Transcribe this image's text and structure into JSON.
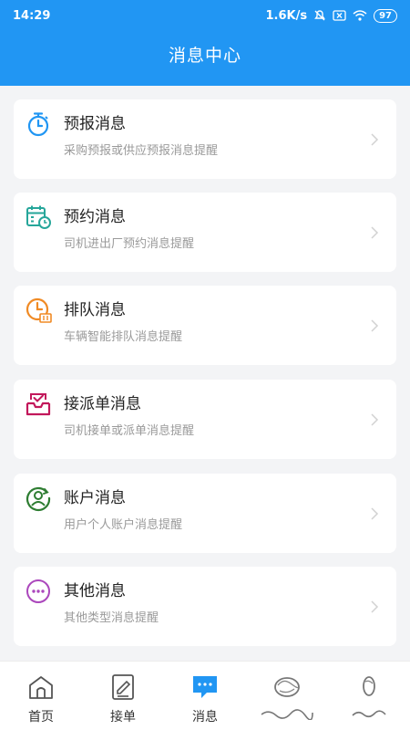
{
  "status_bar": {
    "time": "14:29",
    "speed": "1.6K/s",
    "battery": "97"
  },
  "header": {
    "title": "消息中心"
  },
  "cards": [
    {
      "title": "预报消息",
      "subtitle": "采购预报或供应预报消息提醒",
      "icon": "stopwatch-icon",
      "color": "#2196f3"
    },
    {
      "title": "预约消息",
      "subtitle": "司机进出厂预约消息提醒",
      "icon": "calendar-clock-icon",
      "color": "#26a69a"
    },
    {
      "title": "排队消息",
      "subtitle": "车辆智能排队消息提醒",
      "icon": "queue-clock-icon",
      "color": "#f08a24"
    },
    {
      "title": "接派单消息",
      "subtitle": "司机接单或派单消息提醒",
      "icon": "inbox-check-icon",
      "color": "#c2185b"
    },
    {
      "title": "账户消息",
      "subtitle": "用户个人账户消息提醒",
      "icon": "user-account-icon",
      "color": "#2e7d32"
    },
    {
      "title": "其他消息",
      "subtitle": "其他类型消息提醒",
      "icon": "more-dots-icon",
      "color": "#ab47bc"
    }
  ],
  "tabs": [
    {
      "label": "首页",
      "icon": "home-icon"
    },
    {
      "label": "接单",
      "icon": "order-edit-icon"
    },
    {
      "label": "消息",
      "icon": "chat-bubble-icon",
      "active": true
    },
    {
      "label": "",
      "icon": "scribbled-icon"
    },
    {
      "label": "",
      "icon": "scribbled-icon"
    }
  ],
  "colors": {
    "primary": "#2196f3",
    "background": "#f3f4f6"
  }
}
